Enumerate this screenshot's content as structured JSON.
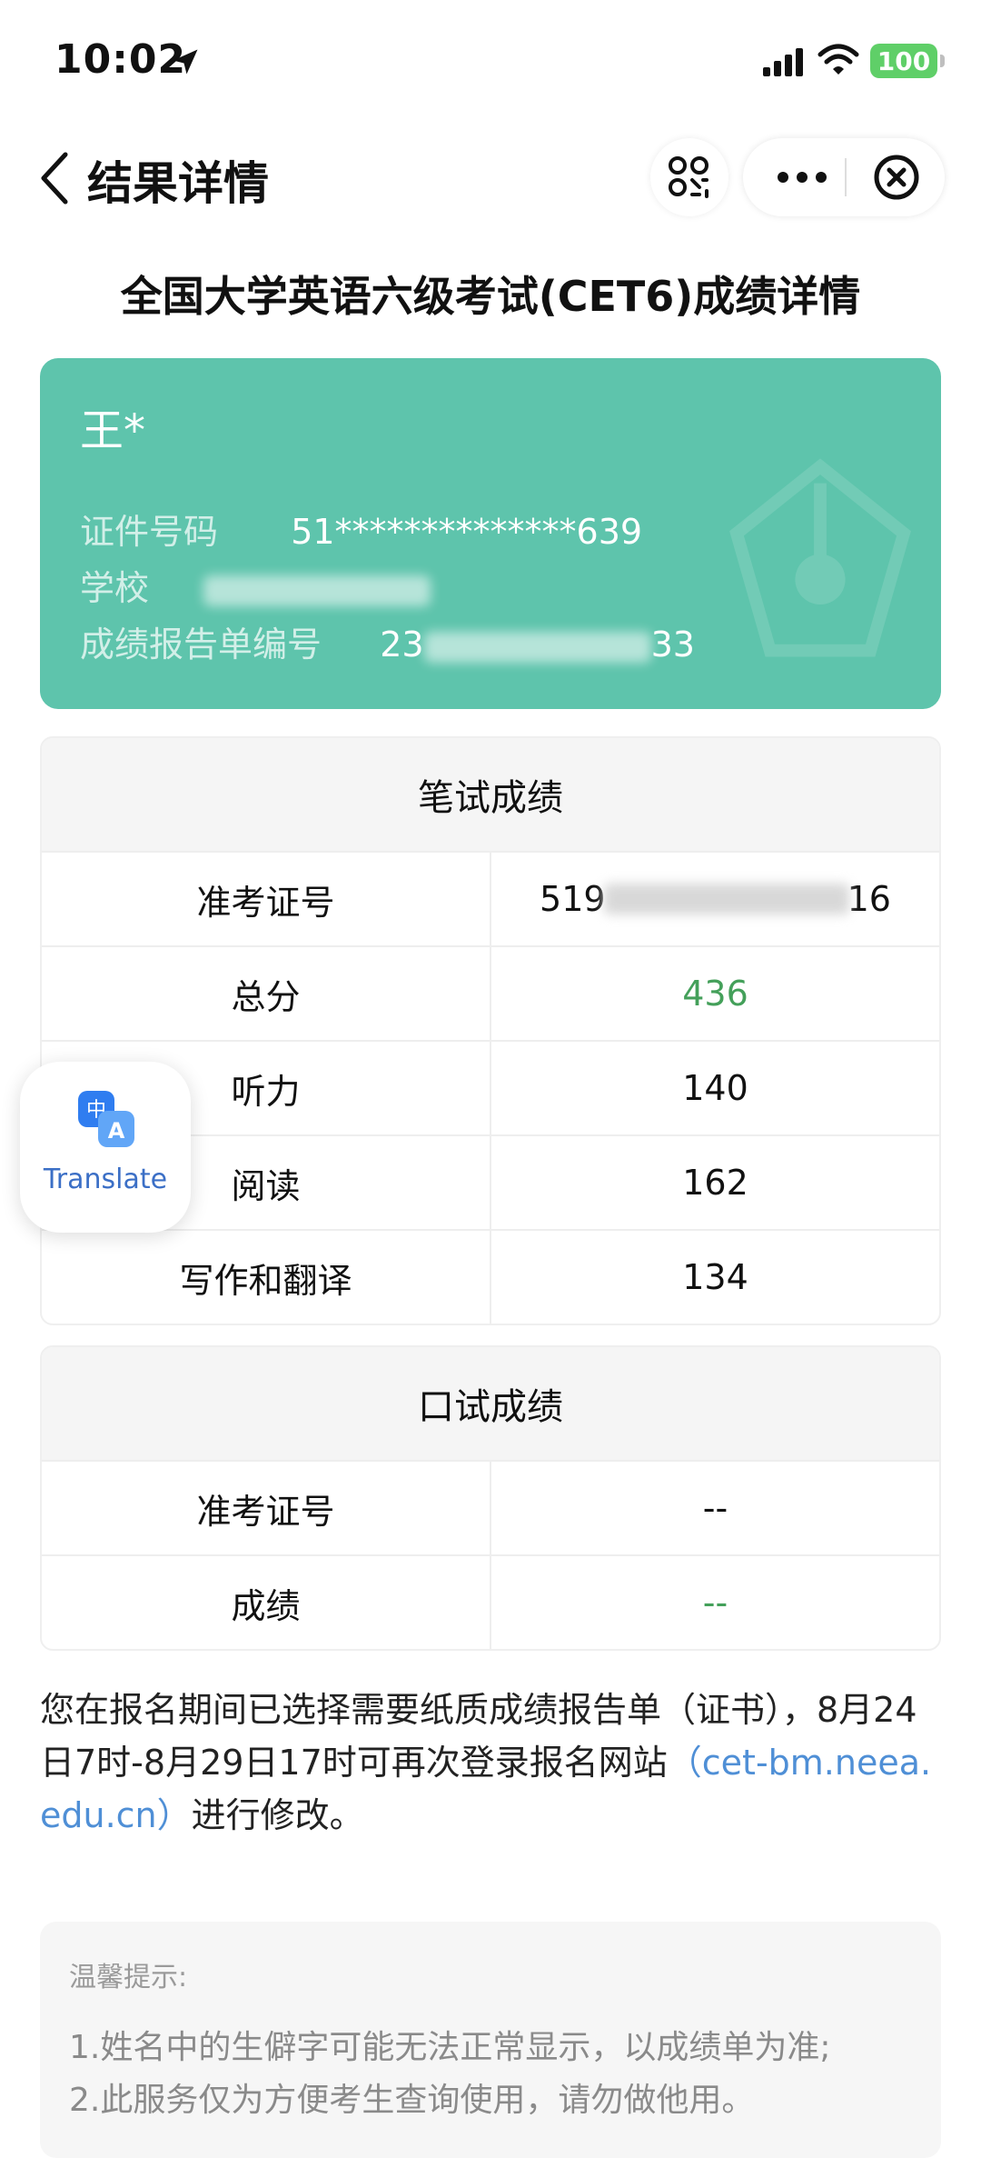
{
  "status_bar": {
    "time": "10:02",
    "battery": "100"
  },
  "nav": {
    "title": "结果详情"
  },
  "heading": "全国大学英语六级考试(CET6)成绩详情",
  "candidate": {
    "name": "王*",
    "id_label": "证件号码",
    "id_value": "51**************639",
    "school_label": "学校",
    "report_label": "成绩报告单编号",
    "report_prefix": "23",
    "report_suffix": "33"
  },
  "written": {
    "header": "笔试成绩",
    "rows": [
      {
        "label": "准考证号",
        "value_prefix": "519",
        "value_suffix": "16"
      },
      {
        "label": "总分",
        "value": "436"
      },
      {
        "label": "听力",
        "value": "140"
      },
      {
        "label": "阅读",
        "value": "162"
      },
      {
        "label": "写作和翻译",
        "value": "134"
      }
    ]
  },
  "oral": {
    "header": "口试成绩",
    "rows": [
      {
        "label": "准考证号",
        "value": "--"
      },
      {
        "label": "成绩",
        "value": "--"
      }
    ]
  },
  "translate_widget": {
    "label": "Translate"
  },
  "notice": {
    "text_before": "您在报名期间已选择需要纸质成绩报告单（证书），8月24日7时-8月29日17时可再次登录报名网站",
    "link": "（cet-bm.neea.edu.cn）",
    "text_after": "进行修改。"
  },
  "tips": {
    "title": "温馨提示:",
    "lines": [
      "1.姓名中的生僻字可能无法正常显示，以成绩单为准;",
      "2.此服务仅为方便考生查询使用，请勿做他用。"
    ]
  },
  "colors": {
    "card": "#5ec4ac",
    "score_green": "#44a05a",
    "link": "#4f8fd6",
    "battery": "#5fcf68"
  }
}
